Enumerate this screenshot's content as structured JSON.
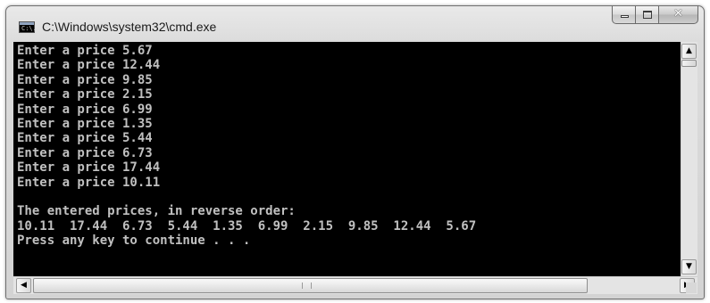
{
  "window": {
    "title": "C:\\Windows\\system32\\cmd.exe",
    "icon": "cmd-icon",
    "icon_text": "C:\\.",
    "buttons": {
      "minimize": "minimize-icon",
      "maximize": "maximize-icon",
      "close": "close-icon"
    }
  },
  "console": {
    "background": "#000000",
    "text_color": "#c0c0c0",
    "lines": [
      "Enter a price 5.67",
      "Enter a price 12.44",
      "Enter a price 9.85",
      "Enter a price 2.15",
      "Enter a price 6.99",
      "Enter a price 1.35",
      "Enter a price 5.44",
      "Enter a price 6.73",
      "Enter a price 17.44",
      "Enter a price 10.11",
      "",
      "The entered prices, in reverse order:",
      "10.11  17.44  6.73  5.44  1.35  6.99  2.15  9.85  12.44  5.67",
      "Press any key to continue . . ."
    ]
  },
  "scrollbars": {
    "vertical": {
      "up": "▲",
      "down": "▼"
    },
    "horizontal": {
      "left": "◀",
      "right": "▶"
    }
  }
}
